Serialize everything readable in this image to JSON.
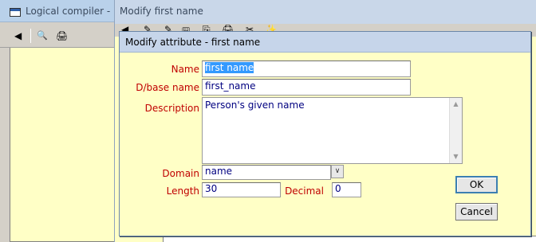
{
  "background_window": {
    "title": "Logical compiler - M",
    "toolbar": {
      "back_glyph": "◀",
      "find_glyph": "🔍",
      "print_glyph": "🖨"
    }
  },
  "middle_window": {
    "title": "Modify first name",
    "toolbar_glyphs": [
      "◀",
      "✎",
      "✎",
      "🖫",
      "⎘",
      "🖨",
      "✂",
      "✨"
    ]
  },
  "dialog": {
    "title": "Modify attribute - first name",
    "name_label": "Name",
    "name_value": "first name",
    "dbname_label": "D/base name",
    "dbname_value": "first_name",
    "description_label": "Description",
    "description_value": "Person's given name",
    "domain_label": "Domain",
    "domain_value": "name",
    "length_label": "Length",
    "length_value": "30",
    "decimal_label": "Decimal",
    "decimal_value": "0",
    "ok_label": "OK",
    "cancel_label": "Cancel"
  },
  "colors": {
    "label_red": "#c00000",
    "field_text": "#000080",
    "panel_yellow": "#ffffc6",
    "selection_blue": "#3399ff"
  }
}
